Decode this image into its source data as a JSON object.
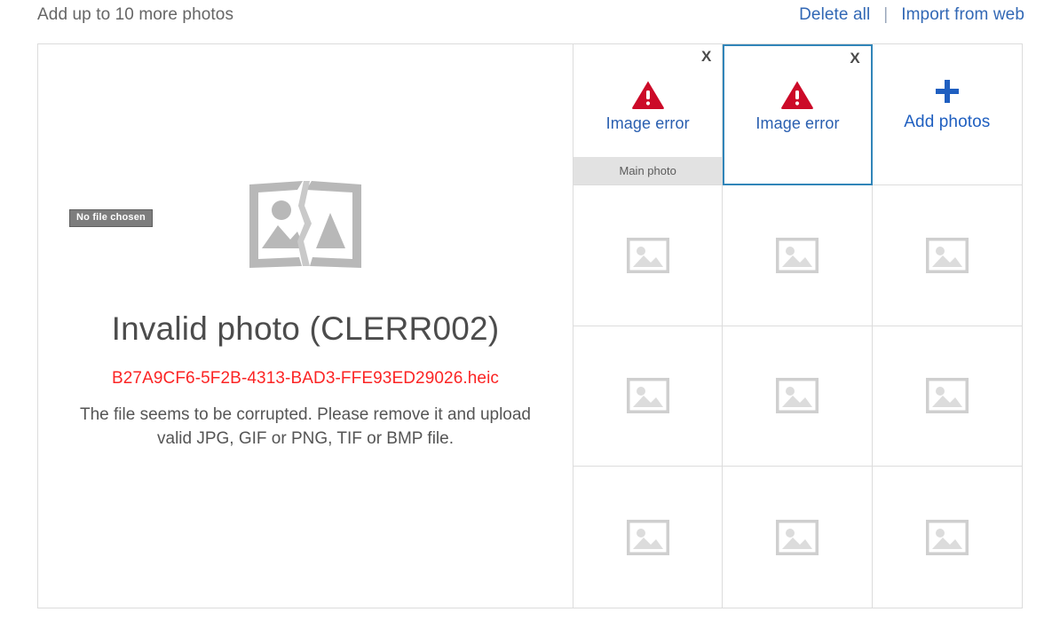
{
  "header": {
    "title": "Add up to 10 more photos",
    "delete_all_label": "Delete all",
    "separator": "|",
    "import_label": "Import from web"
  },
  "preview": {
    "file_chip_label": "No file chosen",
    "broken_image_icon": "broken-image-icon",
    "error_title": "Invalid photo (CLERR002)",
    "error_filename": "B27A9CF6-5F2B-4313-BAD3-FFE93ED29026.heic",
    "error_description": "The file seems to be corrupted. Please remove it and upload valid JPG, GIF or PNG, TIF or BMP file."
  },
  "grid": {
    "close_label": "X",
    "main_photo_badge": "Main photo",
    "error_tile_label": "Image error",
    "warning_icon": "warning-triangle-icon",
    "add_photos_label": "Add photos",
    "plus_icon": "plus-icon",
    "placeholder_icon": "image-placeholder-icon",
    "tiles": [
      {
        "type": "error",
        "label": "Image error",
        "badge": "Main photo",
        "selected": false
      },
      {
        "type": "error",
        "label": "Image error",
        "badge": "",
        "selected": true
      },
      {
        "type": "add",
        "label": "Add photos",
        "badge": "",
        "selected": false
      },
      {
        "type": "empty",
        "label": "",
        "badge": "",
        "selected": false
      },
      {
        "type": "empty",
        "label": "",
        "badge": "",
        "selected": false
      },
      {
        "type": "empty",
        "label": "",
        "badge": "",
        "selected": false
      },
      {
        "type": "empty",
        "label": "",
        "badge": "",
        "selected": false
      },
      {
        "type": "empty",
        "label": "",
        "badge": "",
        "selected": false
      },
      {
        "type": "empty",
        "label": "",
        "badge": "",
        "selected": false
      },
      {
        "type": "empty",
        "label": "",
        "badge": "",
        "selected": false
      },
      {
        "type": "empty",
        "label": "",
        "badge": "",
        "selected": false
      },
      {
        "type": "empty",
        "label": "",
        "badge": "",
        "selected": false
      }
    ]
  },
  "colors": {
    "link_blue": "#3268b5",
    "error_red": "#fb2424",
    "warning_red": "#cc0a28",
    "selected_border": "#3185b9",
    "grid_line": "#dcdcdc",
    "badge_gray": "#e2e2e2",
    "placeholder_gray": "#cccccc"
  }
}
